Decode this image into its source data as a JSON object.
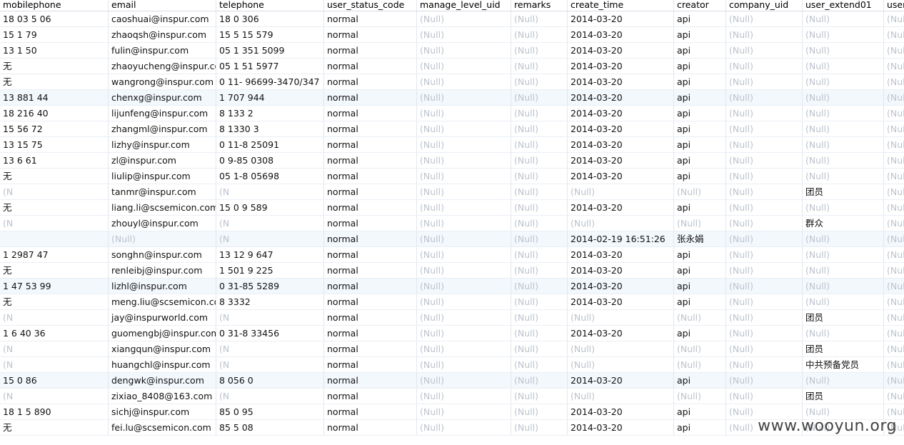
{
  "columns": [
    "mobilephone",
    "email",
    "telephone",
    "user_status_code",
    "manage_level_uid",
    "remarks",
    "create_time",
    "creator",
    "company_uid",
    "user_extend01",
    "user"
  ],
  "null_text": "(Null)",
  "watermark": "www.wooyun.org",
  "rows": [
    [
      "18  03  5   06",
      "caoshuai@inspur.com",
      "18   0   306",
      "normal",
      "(Null)",
      "(Null)",
      "2014-03-20",
      "api",
      "(Null)",
      "(Null)",
      "(Nul"
    ],
    [
      "15   1   79",
      "zhaoqsh@inspur.com",
      "15  5  15  579",
      "normal",
      "(Null)",
      "(Null)",
      "2014-03-20",
      "api",
      "(Null)",
      "(Null)",
      "(Nul"
    ],
    [
      "13   1   50",
      "fulin@inspur.com",
      "05  1  351  5099",
      "normal",
      "(Null)",
      "(Null)",
      "2014-03-20",
      "api",
      "(Null)",
      "(Null)",
      "(Nul"
    ],
    [
      "无",
      "zhaoyucheng@inspur.com",
      "05  1  51  5977",
      "normal",
      "(Null)",
      "(Null)",
      "2014-03-20",
      "api",
      "(Null)",
      "(Null)",
      "(Nul"
    ],
    [
      "无",
      "wangrong@inspur.com",
      "0  11-  96699-3470/347",
      "normal",
      "(Null)",
      "(Null)",
      "2014-03-20",
      "api",
      "(Null)",
      "(Null)",
      "(Nul"
    ],
    [
      "13   881  44",
      "chenxg@inspur.com",
      "1  707   944",
      "normal",
      "(Null)",
      "(Null)",
      "2014-03-20",
      "api",
      "(Null)",
      "(Null)",
      "(Nul"
    ],
    [
      "18   216  40",
      "lijunfeng@inspur.com",
      "8  133   2",
      "normal",
      "(Null)",
      "(Null)",
      "2014-03-20",
      "api",
      "(Null)",
      "(Null)",
      "(Nul"
    ],
    [
      "15   56  72",
      "zhangml@inspur.com",
      "8  1330  3",
      "normal",
      "(Null)",
      "(Null)",
      "2014-03-20",
      "api",
      "(Null)",
      "(Null)",
      "(Nul"
    ],
    [
      "13   15  75",
      "lizhy@inspur.com",
      "0  11-8  25091",
      "normal",
      "(Null)",
      "(Null)",
      "2014-03-20",
      "api",
      "(Null)",
      "(Null)",
      "(Nul"
    ],
    [
      "13   6  61",
      "zl@inspur.com",
      "0  9-85  0308",
      "normal",
      "(Null)",
      "(Null)",
      "2014-03-20",
      "api",
      "(Null)",
      "(Null)",
      "(Nul"
    ],
    [
      "无",
      "liulip@inspur.com",
      "05  1-8  05698",
      "normal",
      "(Null)",
      "(Null)",
      "2014-03-20",
      "api",
      "(Null)",
      "(Null)",
      "(Nul"
    ],
    [
      "(N",
      "tanmr@inspur.com",
      "(N",
      "normal",
      "(Null)",
      "(Null)",
      "(Null)",
      "(Null)",
      "(Null)",
      "团员",
      "(Nul"
    ],
    [
      "无",
      "liang.li@scsemicon.com",
      "15  0  9  589",
      "normal",
      "(Null)",
      "(Null)",
      "2014-03-20",
      "api",
      "(Null)",
      "(Null)",
      "(Nul"
    ],
    [
      "(N",
      "zhouyl@inspur.com",
      "(N",
      "normal",
      "(Null)",
      "(Null)",
      "(Null)",
      "(Null)",
      "(Null)",
      "群众",
      "(Nul"
    ],
    [
      "",
      "(Null)",
      "(N",
      "normal",
      "(Null)",
      "(Null)",
      "2014-02-19 16:51:26",
      "张永娟",
      "(Null)",
      "(Null)",
      "(Nul"
    ],
    [
      "1  2987  47",
      "songhn@inspur.com",
      "13  12  9  647",
      "normal",
      "(Null)",
      "(Null)",
      "2014-03-20",
      "api",
      "(Null)",
      "(Null)",
      "(Nul"
    ],
    [
      "无",
      "renleibj@inspur.com",
      "1  501  9  225",
      "normal",
      "(Null)",
      "(Null)",
      "2014-03-20",
      "api",
      "(Null)",
      "(Null)",
      "(Nul"
    ],
    [
      "1  47  53  99",
      "lizhl@inspur.com",
      "0  31-85  5289",
      "normal",
      "(Null)",
      "(Null)",
      "2014-03-20",
      "api",
      "(Null)",
      "(Null)",
      "(Nul"
    ],
    [
      "无",
      "meng.liu@scsemicon.com",
      "8  3332",
      "normal",
      "(Null)",
      "(Null)",
      "2014-03-20",
      "api",
      "(Null)",
      "(Null)",
      "(Nul"
    ],
    [
      "(N",
      "jay@inspurworld.com",
      "(N",
      "normal",
      "(Null)",
      "(Null)",
      "(Null)",
      "(Null)",
      "(Null)",
      "团员",
      "(Nul"
    ],
    [
      "1  6  40  36",
      "guomengbj@inspur.com",
      "0  31-8  33456",
      "normal",
      "(Null)",
      "(Null)",
      "2014-03-20",
      "api",
      "(Null)",
      "(Null)",
      "(Nul"
    ],
    [
      "(N",
      "xiangqun@inspur.com",
      "(N",
      "normal",
      "(Null)",
      "(Null)",
      "(Null)",
      "(Null)",
      "(Null)",
      "团员",
      "(Nul"
    ],
    [
      "(N",
      "huangchl@inspur.com",
      "(N",
      "normal",
      "(Null)",
      "(Null)",
      "(Null)",
      "(Null)",
      "(Null)",
      "中共预备党员",
      "(Nul"
    ],
    [
      "15   0  86",
      "dengwk@inspur.com",
      "8  056  0",
      "normal",
      "(Null)",
      "(Null)",
      "2014-03-20",
      "api",
      "(Null)",
      "(Null)",
      "(Nul"
    ],
    [
      "(N",
      "zixiao_8408@163.com",
      "(N",
      "normal",
      "(Null)",
      "(Null)",
      "(Null)",
      "(Null)",
      "(Null)",
      "团员",
      "(Nul"
    ],
    [
      "18  1  5  890",
      "sichj@inspur.com",
      "85  0  95",
      "normal",
      "(Null)",
      "(Null)",
      "2014-03-20",
      "api",
      "(Null)",
      "(Null)",
      "(Nul"
    ],
    [
      "无",
      "fei.lu@scsemicon.com",
      "85  5  08",
      "normal",
      "(Null)",
      "(Null)",
      "2014-03-20",
      "api",
      "(Null)",
      "(Null)",
      "(Nul"
    ]
  ]
}
